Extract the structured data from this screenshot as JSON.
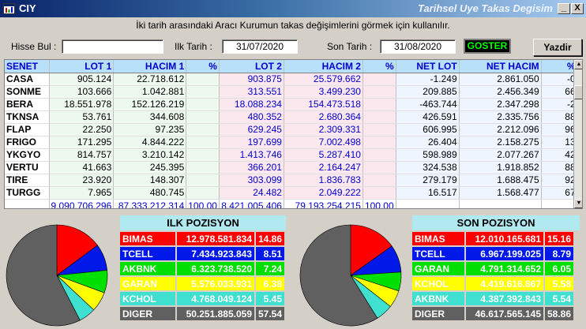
{
  "window": {
    "app_title": "CIY",
    "title": "Tarihsel Uye Takas Degisim",
    "min_label": "_",
    "close_label": "X",
    "accent": "#0a246a"
  },
  "info_text": "İki tarih arasındaki  Aracı Kurumun takas değişimlerini görmek için kullanılır.",
  "controls": {
    "hisse_label": "Hisse Bul :",
    "hisse_value": "",
    "ilk_label": "Ilk Tarih :",
    "ilk_value": "31/07/2020",
    "son_label": "Son Tarih :",
    "son_value": "31/08/2020",
    "goster_label": "GOSTER",
    "yazdir_label": "Yazdir"
  },
  "table": {
    "headers": [
      "SENET",
      "LOT 1",
      "HACIM 1",
      "%",
      "LOT 2",
      "HACIM 2",
      "%",
      "NET LOT",
      "NET HACIM",
      "%"
    ],
    "rows": [
      [
        "CASA",
        "905.124",
        "22.718.612",
        "",
        "903.875",
        "25.579.662",
        "",
        "-1.249",
        "2.861.050",
        "-0"
      ],
      [
        "SONME",
        "103.666",
        "1.042.881",
        "",
        "313.551",
        "3.499.230",
        "",
        "209.885",
        "2.456.349",
        "66"
      ],
      [
        "BERA",
        "18.551.978",
        "152.126.219",
        "",
        "18.088.234",
        "154.473.518",
        "",
        "-463.744",
        "2.347.298",
        "-2"
      ],
      [
        "TKNSA",
        "53.761",
        "344.608",
        "",
        "480.352",
        "2.680.364",
        "",
        "426.591",
        "2.335.756",
        "88"
      ],
      [
        "FLAP",
        "22.250",
        "97.235",
        "",
        "629.245",
        "2.309.331",
        "",
        "606.995",
        "2.212.096",
        "96"
      ],
      [
        "FRIGO",
        "171.295",
        "4.844.222",
        "",
        "197.699",
        "7.002.498",
        "",
        "26.404",
        "2.158.275",
        "13"
      ],
      [
        "YKGYO",
        "814.757",
        "3.210.142",
        "",
        "1.413.746",
        "5.287.410",
        "",
        "598.989",
        "2.077.267",
        "42"
      ],
      [
        "VERTU",
        "41.663",
        "245.395",
        "",
        "366.201",
        "2.164.247",
        "",
        "324.538",
        "1.918.852",
        "88"
      ],
      [
        "TIRE",
        "23.920",
        "148.307",
        "",
        "303.099",
        "1.836.783",
        "",
        "279.179",
        "1.688.475",
        "92"
      ],
      [
        "TURGG",
        "7.965",
        "480.745",
        "",
        "24.482",
        "2.049.222",
        "",
        "16.517",
        "1.568.477",
        "67"
      ]
    ],
    "totals": [
      "",
      "9.090.706.296",
      "87.333.212.314",
      "100,00",
      "8.421.005.406",
      "79.193.254.215",
      "100,00",
      "",
      "",
      ""
    ]
  },
  "ilk_pozisyon": {
    "title": "ILK POZISYON",
    "rows": [
      {
        "name": "BIMAS",
        "value": "12.978.581.834",
        "pct": "14.86",
        "pct_num": 14.86,
        "color": "#ff0000"
      },
      {
        "name": "TCELL",
        "value": "7.434.923.843",
        "pct": "8.51",
        "pct_num": 8.51,
        "color": "#0018e8"
      },
      {
        "name": "AKBNK",
        "value": "6.323.738.520",
        "pct": "7.24",
        "pct_num": 7.24,
        "color": "#00e000"
      },
      {
        "name": "GARAN",
        "value": "5.576.033.931",
        "pct": "6.38",
        "pct_num": 6.38,
        "color": "#ffff00"
      },
      {
        "name": "KCHOL",
        "value": "4.768.049.124",
        "pct": "5.45",
        "pct_num": 5.45,
        "color": "#40e0d0"
      },
      {
        "name": "DIGER",
        "value": "50.251.885.059",
        "pct": "57.54",
        "pct_num": 57.54,
        "color": "#606060"
      }
    ]
  },
  "son_pozisyon": {
    "title": "SON POZISYON",
    "rows": [
      {
        "name": "BIMAS",
        "value": "12.010.165.681",
        "pct": "15.16",
        "pct_num": 15.16,
        "color": "#ff0000"
      },
      {
        "name": "TCELL",
        "value": "6.967.199.025",
        "pct": "8.79",
        "pct_num": 8.79,
        "color": "#0018e8"
      },
      {
        "name": "GARAN",
        "value": "4.791.314.652",
        "pct": "6.05",
        "pct_num": 6.05,
        "color": "#00e000"
      },
      {
        "name": "KCHOL",
        "value": "4.419.616.867",
        "pct": "5.58",
        "pct_num": 5.58,
        "color": "#ffff00"
      },
      {
        "name": "AKBNK",
        "value": "4.387.392.843",
        "pct": "5.54",
        "pct_num": 5.54,
        "color": "#40e0d0"
      },
      {
        "name": "DIGER",
        "value": "46.617.565.145",
        "pct": "58.86",
        "pct_num": 58.86,
        "color": "#606060"
      }
    ]
  },
  "icons": {
    "app": "app-window-icon",
    "min": "minimize-icon",
    "close": "close-icon",
    "scroll_up": "scroll-up-arrow-icon",
    "scroll_down": "scroll-down-arrow-icon"
  }
}
